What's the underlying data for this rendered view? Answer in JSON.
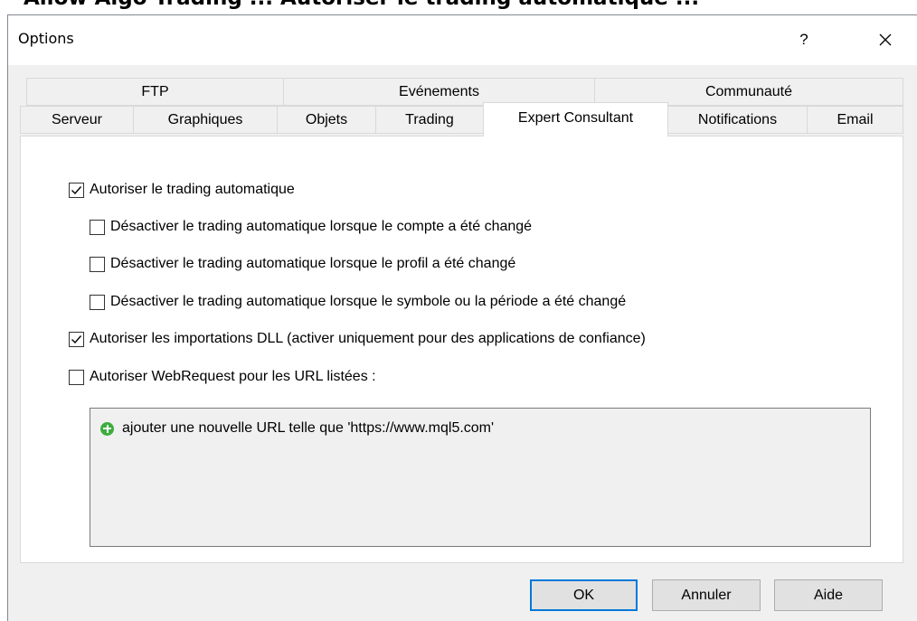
{
  "background_text": "Allow Algo Trading ... Autoriser le trading automatique ...",
  "window": {
    "title": "Options",
    "help_label": "?",
    "close_label": "✕"
  },
  "tabs": {
    "row1": [
      "FTP",
      "Evénements",
      "Communauté"
    ],
    "row2": [
      "Serveur",
      "Graphiques",
      "Objets",
      "Trading",
      "Expert Consultant",
      "Notifications",
      "Email"
    ],
    "active": "Expert Consultant"
  },
  "options": {
    "allow_algo": {
      "label": "Autoriser le trading automatique",
      "checked": true
    },
    "disable_account": {
      "label": "Désactiver le trading automatique lorsque le compte a été changé",
      "checked": false
    },
    "disable_profile": {
      "label": "Désactiver le trading automatique lorsque le profil a été changé",
      "checked": false
    },
    "disable_symbol": {
      "label": "Désactiver le trading automatique lorsque le symbole ou la période a été changé",
      "checked": false
    },
    "allow_dll": {
      "label": "Autoriser les importations DLL (activer uniquement pour des applications de confiance)",
      "checked": true
    },
    "allow_webrequest": {
      "label": "Autoriser WebRequest pour les URL listées :",
      "checked": false
    }
  },
  "url_list": {
    "add_hint": "ajouter une nouvelle URL telle que 'https://www.mql5.com'",
    "icon": "add-circle-icon"
  },
  "buttons": {
    "ok": "OK",
    "cancel": "Annuler",
    "help": "Aide"
  },
  "colors": {
    "accent": "#0078d7",
    "add_icon": "#3dad3d"
  }
}
